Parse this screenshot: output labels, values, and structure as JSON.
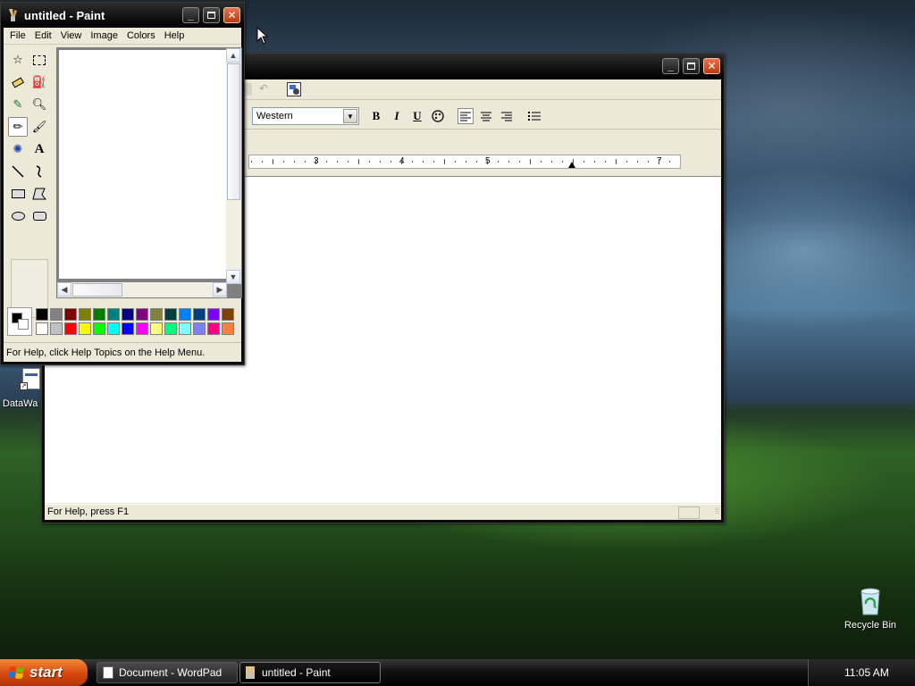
{
  "wordpad": {
    "title": "",
    "script_select": "Western",
    "bold": "B",
    "italic": "I",
    "underline": "U",
    "ruler_numbers": [
      "3",
      "4",
      "5",
      "7"
    ],
    "status": "For Help, press F1"
  },
  "paint": {
    "title": "untitled - Paint",
    "menu": [
      "File",
      "Edit",
      "View",
      "Image",
      "Colors",
      "Help"
    ],
    "status": "For Help, click Help Topics on the Help Menu.",
    "tools": [
      "free-select-icon",
      "rect-select-icon",
      "eraser-icon",
      "fill-icon",
      "eyedropper-icon",
      "magnifier-icon",
      "pencil-icon",
      "brush-icon",
      "airbrush-icon",
      "text-icon",
      "line-icon",
      "curve-icon",
      "rectangle-icon",
      "polygon-icon",
      "ellipse-icon",
      "rounded-rect-icon"
    ],
    "active_tool": "pencil-icon",
    "foreground_color": "#000000",
    "background_color": "#ffffff",
    "palette_top": [
      "#000000",
      "#808080",
      "#800000",
      "#808000",
      "#008000",
      "#008080",
      "#000080",
      "#800080",
      "#808040",
      "#004040",
      "#0080ff",
      "#004080",
      "#8000ff",
      "#804000"
    ],
    "palette_bottom": [
      "#ffffff",
      "#c0c0c0",
      "#ff0000",
      "#ffff00",
      "#00ff00",
      "#00ffff",
      "#0000ff",
      "#ff00ff",
      "#ffff80",
      "#00ff80",
      "#80ffff",
      "#8080ff",
      "#ff0080",
      "#ff8040"
    ]
  },
  "desktop": {
    "icons": [
      {
        "label": "DataWa"
      },
      {
        "label": "Recycle Bin"
      }
    ]
  },
  "taskbar": {
    "start_label": "start",
    "tasks": [
      {
        "label": "Document - WordPad"
      },
      {
        "label": "untitled - Paint"
      }
    ],
    "clock": "11:05 AM"
  },
  "colors": {
    "start": "#d8480c",
    "close_button": "#c64b25",
    "titlebar": "#111111"
  }
}
